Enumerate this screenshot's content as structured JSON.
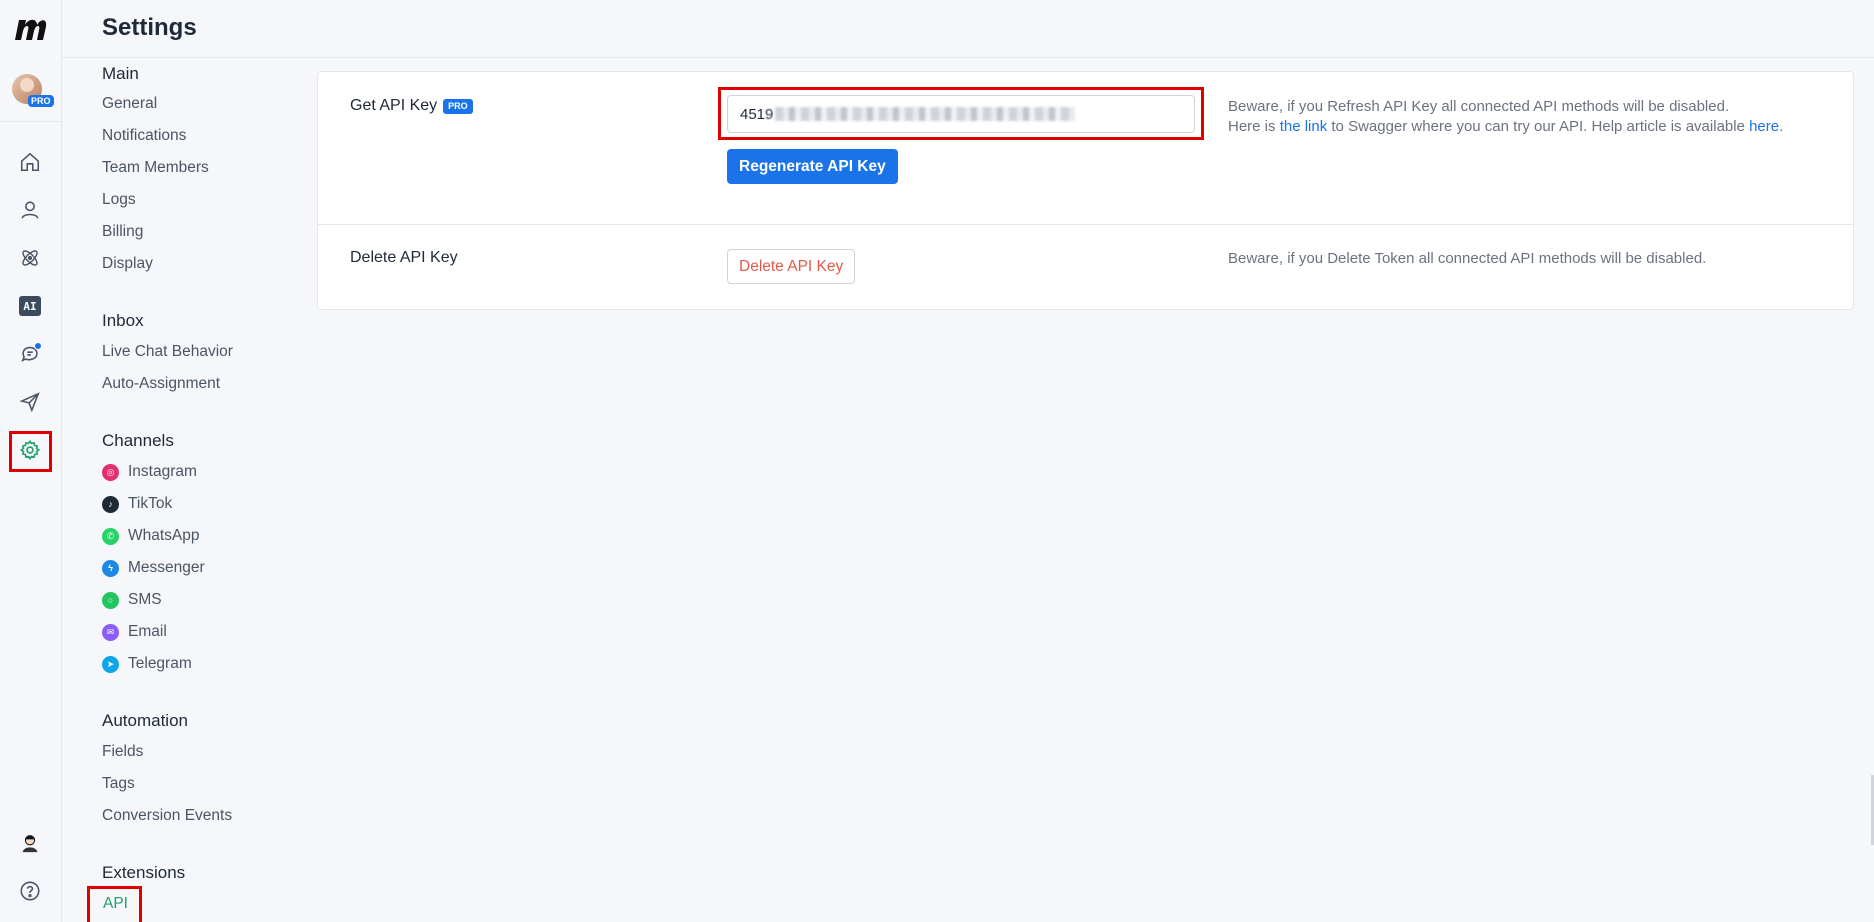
{
  "header": {
    "title": "Settings"
  },
  "rail": {
    "avatar_badge": "PRO",
    "ai_label": "AI",
    "icons": [
      "home-icon",
      "contacts-icon",
      "automation-icon",
      "ai-icon",
      "chat-icon",
      "send-icon",
      "gear-icon"
    ],
    "bottom_icons": [
      "user-avatar-icon",
      "help-icon"
    ]
  },
  "nav": {
    "main": {
      "title": "Main",
      "items": [
        "General",
        "Notifications",
        "Team Members",
        "Logs",
        "Billing",
        "Display"
      ]
    },
    "inbox": {
      "title": "Inbox",
      "items": [
        "Live Chat Behavior",
        "Auto-Assignment"
      ]
    },
    "channels": {
      "title": "Channels",
      "items": [
        {
          "label": "Instagram",
          "color": "#e1306c"
        },
        {
          "label": "TikTok",
          "color": "#1f2937"
        },
        {
          "label": "WhatsApp",
          "color": "#25d366"
        },
        {
          "label": "Messenger",
          "color": "#1e88e5"
        },
        {
          "label": "SMS",
          "color": "#22c55e"
        },
        {
          "label": "Email",
          "color": "#8b5cf6"
        },
        {
          "label": "Telegram",
          "color": "#0ea5e9"
        }
      ]
    },
    "automation": {
      "title": "Automation",
      "items": [
        "Fields",
        "Tags",
        "Conversion Events"
      ]
    },
    "extensions": {
      "title": "Extensions",
      "items": [
        "API"
      ]
    }
  },
  "api": {
    "get_label": "Get API Key",
    "pro_badge": "PRO",
    "key_prefix": "451",
    "key_visible_char": "9",
    "regenerate_label": "Regenerate API Key",
    "get_desc_line1": "Beware, if you Refresh API Key all connected API methods will be disabled.",
    "get_desc_line2_a": "Here is ",
    "get_desc_link1": "the link",
    "get_desc_line2_b": " to Swagger where you can try our API. Help article is available ",
    "get_desc_link2": "here",
    "get_desc_line2_c": ".",
    "delete_label": "Delete API Key",
    "delete_button": "Delete API Key",
    "delete_desc": "Beware, if you Delete Token all connected API methods will be disabled."
  },
  "colors": {
    "accent": "#1a73e8",
    "active": "#22a06b",
    "danger": "#e05a47",
    "highlight": "#e00000"
  }
}
